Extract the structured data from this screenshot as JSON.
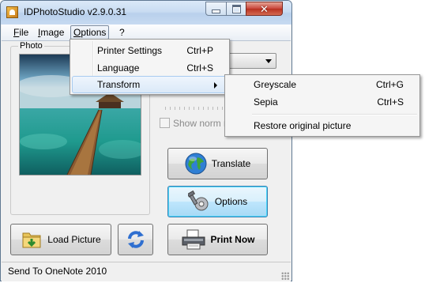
{
  "window": {
    "title": "IDPhotoStudio v2.9.0.31"
  },
  "menubar": {
    "file": "File",
    "image": "Image",
    "options": "Options",
    "help": "?"
  },
  "options_menu": {
    "items": [
      {
        "label": "Printer Settings",
        "shortcut": "Ctrl+P"
      },
      {
        "label": "Language",
        "shortcut": "Ctrl+S"
      },
      {
        "label": "Transform",
        "shortcut": ""
      }
    ]
  },
  "transform_menu": {
    "items": [
      {
        "label": "Greyscale",
        "shortcut": "Ctrl+G"
      },
      {
        "label": "Sepia",
        "shortcut": "Ctrl+S"
      },
      {
        "label": "Restore original picture",
        "shortcut": ""
      }
    ]
  },
  "photo_group": {
    "label": "Photo"
  },
  "controls": {
    "show_norm_label": "Show norm ma"
  },
  "buttons": {
    "translate": "Translate",
    "options": "Options",
    "print_now": "Print Now",
    "load_picture": "Load Picture"
  },
  "status": {
    "text": "Send To OneNote 2010"
  },
  "colors": {
    "title_bar": "#c9dcf2",
    "menu_highlight": "#dbe9f8",
    "close_button": "#c9453a"
  }
}
